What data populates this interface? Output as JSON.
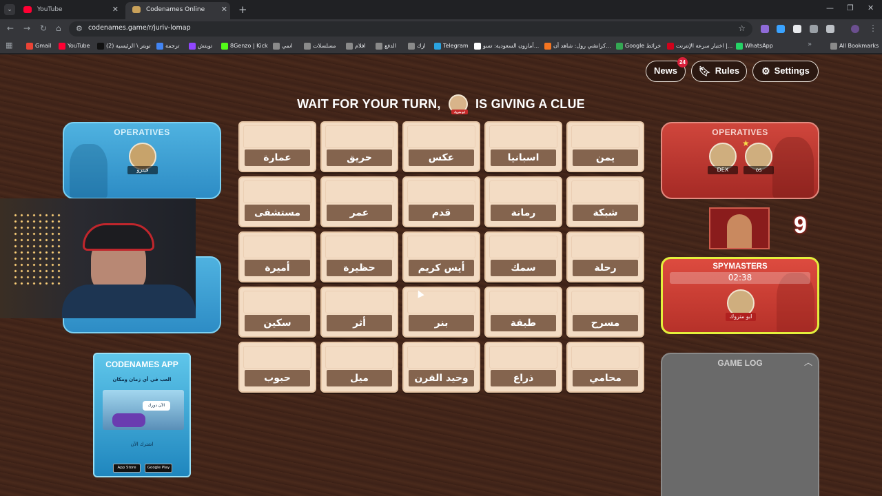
{
  "browser": {
    "tabs": [
      {
        "title": "YouTube",
        "active": false,
        "favicon_color": "#ff0033"
      },
      {
        "title": "Codenames Online",
        "active": true,
        "favicon_color": "#c9a15a"
      }
    ],
    "url": "codenames.game/r/juriv-lomap",
    "bookmarks": [
      {
        "label": "Gmail",
        "color": "#ea4335"
      },
      {
        "label": "YouTube",
        "color": "#ff0033"
      },
      {
        "label": "(2) تويتر \\ الرئيسية",
        "color": "#111111"
      },
      {
        "label": "ترجمة",
        "color": "#4285f4"
      },
      {
        "label": "تويتش",
        "color": "#9146ff"
      },
      {
        "label": "8Genzo | Kick",
        "color": "#53fc18"
      },
      {
        "label": "انمي",
        "color": "#8a8a8a"
      },
      {
        "label": "مسلسلات",
        "color": "#8a8a8a"
      },
      {
        "label": "افلام",
        "color": "#8a8a8a"
      },
      {
        "label": "الدفع",
        "color": "#8a8a8a"
      },
      {
        "label": "ازك",
        "color": "#8a8a8a"
      },
      {
        "label": "Telegram",
        "color": "#2aa3e0"
      },
      {
        "label": "أمازون السعودية: تسو...",
        "color": "#ffffff"
      },
      {
        "label": "كرانشي رول: شاهد أن...",
        "color": "#f47521"
      },
      {
        "label": "Google خرائط",
        "color": "#34a853"
      },
      {
        "label": "اختبار سرعة الإنترنت |...",
        "color": "#d0021b"
      },
      {
        "label": "WhatsApp",
        "color": "#25d366"
      }
    ],
    "all_bookmarks": "All Bookmarks"
  },
  "game": {
    "nav": {
      "news": "News",
      "news_badge": "24",
      "rules": "Rules",
      "settings": "Settings"
    },
    "status": {
      "prefix": "WAIT FOR YOUR TURN,",
      "suffix": "IS GIVING A CLUE",
      "spymaster_tag": "ابو متروك"
    },
    "blue_team": {
      "title": "OPERATIVES",
      "players": [
        {
          "name": "فيتزو"
        }
      ]
    },
    "red_team": {
      "title": "OPERATIVES",
      "players": [
        {
          "name": "DEX"
        },
        {
          "name": "os"
        }
      ]
    },
    "red_cards_remaining": "9",
    "spymasters": {
      "title": "SPYMASTERS",
      "timer": "02:38",
      "player": "ابو متروك"
    },
    "game_log": {
      "title": "GAME LOG"
    },
    "app_ad": {
      "title": "CODENAMES APP",
      "tagline": "العب في أي زمان ومكان",
      "bubble": "الآن دورك",
      "cta": "اشترك الآن",
      "app_store": "App Store",
      "google_play": "Google Play"
    },
    "cards": [
      "عمارة",
      "حريق",
      "عكس",
      "اسبانيا",
      "يمن",
      "مستشفى",
      "عمر",
      "قدم",
      "رمانة",
      "شبكة",
      "أميرة",
      "حظيرة",
      "أيس كريم",
      "سمك",
      "رحلة",
      "سكين",
      "أثر",
      "بنر",
      "طبقة",
      "مسرح",
      "حبوب",
      "ميل",
      "وحيد القرن",
      "ذراع",
      "محامي"
    ]
  }
}
